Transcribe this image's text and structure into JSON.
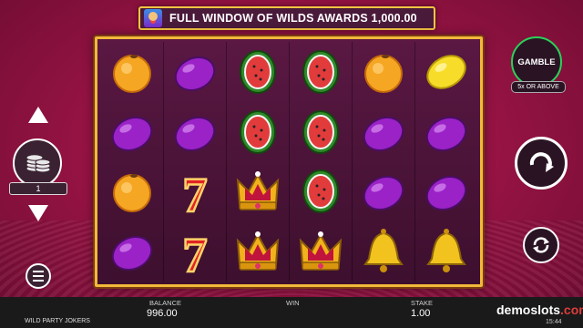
{
  "banner": {
    "text": "FULL WINDOW OF WILDS AWARDS 1,000.00",
    "icon": "joker-icon"
  },
  "reels": [
    [
      "orange",
      "plum",
      "orange",
      "plum"
    ],
    [
      "plum",
      "plum",
      "seven",
      "seven"
    ],
    [
      "watermelon",
      "watermelon",
      "crown",
      "crown"
    ],
    [
      "watermelon",
      "watermelon",
      "watermelon",
      "crown"
    ],
    [
      "orange",
      "plum",
      "plum",
      "bell"
    ],
    [
      "lemon",
      "plum",
      "plum",
      "bell"
    ]
  ],
  "left_controls": {
    "bet_level": "1",
    "icons": [
      "arrow-up-icon",
      "coin-stack-icon",
      "arrow-down-icon",
      "menu-icon"
    ]
  },
  "right_controls": {
    "gamble_label": "GAMBLE",
    "gamble_sub": "5x OR ABOVE",
    "icons": [
      "spin-icon",
      "autoplay-icon"
    ]
  },
  "bottom": {
    "balance_label": "BALANCE",
    "balance_value": "996.00",
    "win_label": "WIN",
    "stake_label": "STAKE",
    "stake_value": "1.00",
    "game_name": "WILD PARTY JOKERS",
    "logo_main": "demoslots",
    "logo_tld": ".com",
    "clock": "15:44"
  },
  "colors": {
    "frame": "#f2b93b",
    "background": "#9a1445",
    "gamble_ring": "#2ad15a"
  }
}
